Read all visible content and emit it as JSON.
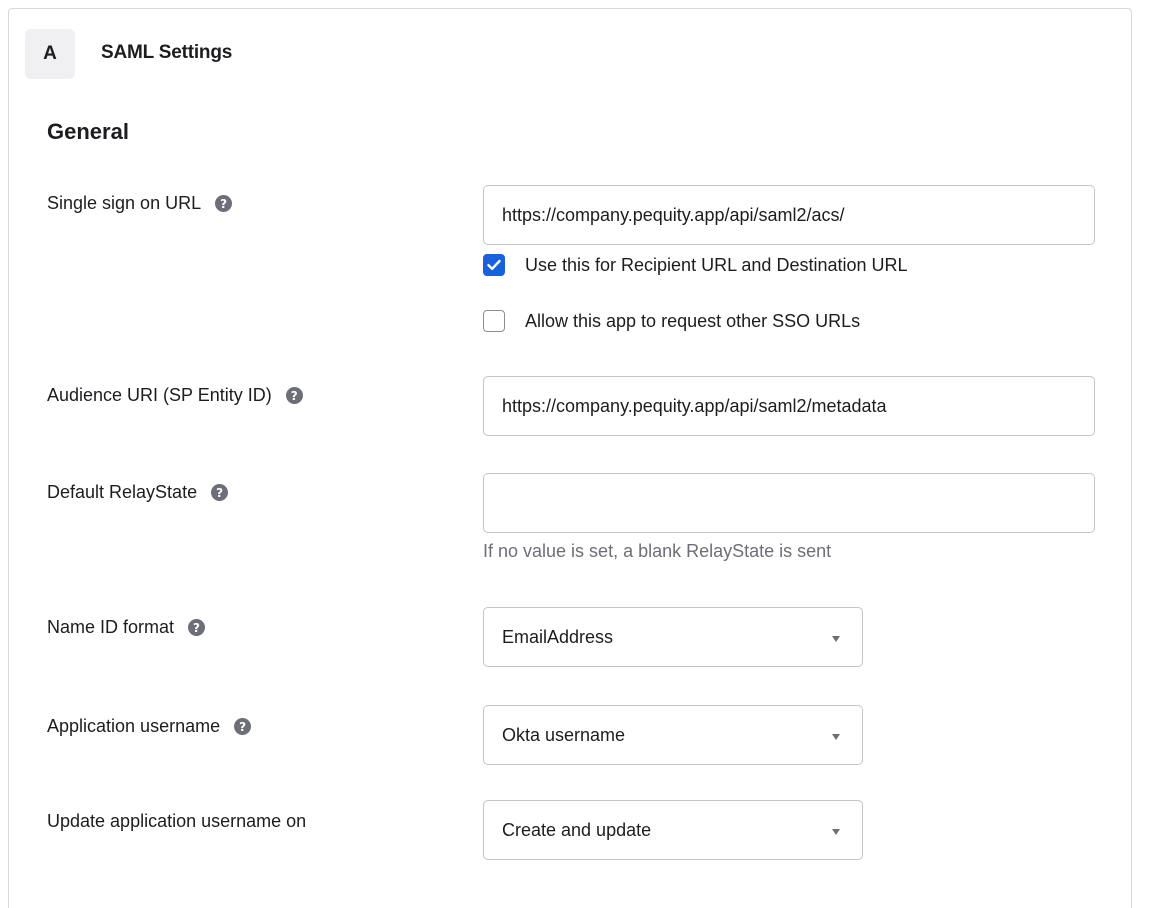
{
  "step": {
    "letter": "A",
    "title": "SAML Settings"
  },
  "section": {
    "title": "General"
  },
  "fields": {
    "sso_url": {
      "label": "Single sign on URL",
      "value": "https://company.pequity.app/api/saml2/acs/",
      "help_icon": "?"
    },
    "recipient_checkbox": {
      "label": "Use this for Recipient URL and Destination URL",
      "checked": true
    },
    "other_sso_checkbox": {
      "label": "Allow this app to request other SSO URLs",
      "checked": false
    },
    "audience_uri": {
      "label": "Audience URI (SP Entity ID)",
      "value": "https://company.pequity.app/api/saml2/metadata",
      "help_icon": "?"
    },
    "relay_state": {
      "label": "Default RelayState",
      "value": "",
      "hint": "If no value is set, a blank RelayState is sent",
      "help_icon": "?"
    },
    "name_id_format": {
      "label": "Name ID format",
      "selected": "EmailAddress",
      "help_icon": "?"
    },
    "app_username": {
      "label": "Application username",
      "selected": "Okta username",
      "help_icon": "?"
    },
    "update_username_on": {
      "label": "Update application username on",
      "selected": "Create and update"
    }
  },
  "colors": {
    "accent": "#1662dd",
    "border": "#c4c4c9",
    "muted_text": "#6e6e78",
    "badge_bg": "#f0f0f2"
  }
}
